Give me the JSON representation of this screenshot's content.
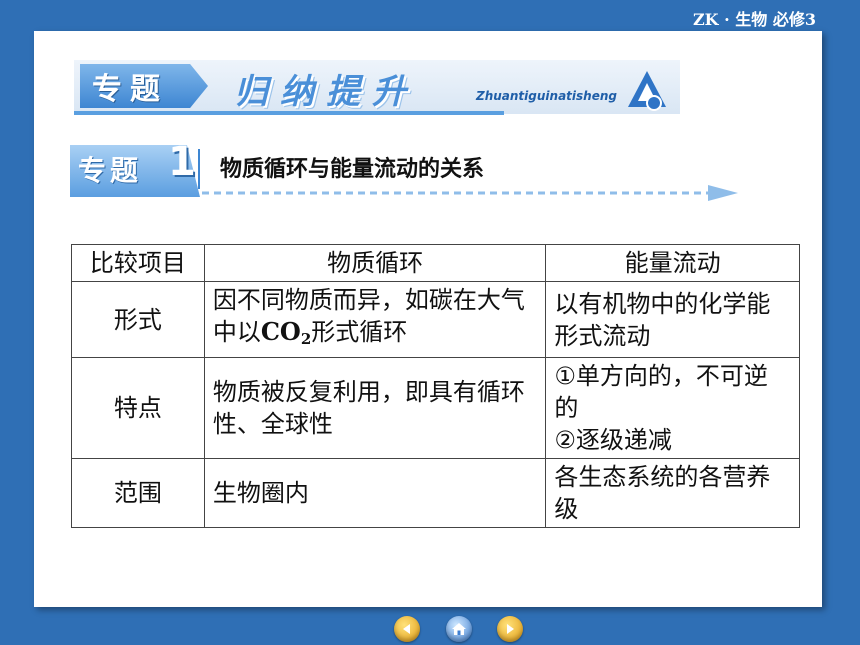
{
  "topbar": {
    "label": "ZK · 生物  必修3"
  },
  "header": {
    "badge": "专题",
    "title": "归纳提升",
    "pinyin": "Zhuantiguinatisheng"
  },
  "topic": {
    "badge_text": "专题",
    "badge_number": "1",
    "title": "物质循环与能量流动的关系"
  },
  "table": {
    "headers": [
      "比较项目",
      "物质循环",
      "能量流动"
    ],
    "rows": [
      {
        "label": "形式",
        "material_a": "因不同物质而异，如碳在大气中以",
        "material_co": "CO",
        "material_sub": "2",
        "material_b": "形式循环",
        "energy": "以有机物中的化学能形式流动"
      },
      {
        "label": "特点",
        "material": "物质被反复利用，即具有循环性、全球性",
        "energy_1": "①单方向的，不可逆的",
        "energy_2": "②逐级递减"
      },
      {
        "label": "范围",
        "material": "生物圈内",
        "energy": "各生态系统的各营养级"
      }
    ]
  },
  "nav": {
    "prev_icon": "back-arrow-icon",
    "home_icon": "home-icon",
    "next_icon": "forward-arrow-icon"
  }
}
